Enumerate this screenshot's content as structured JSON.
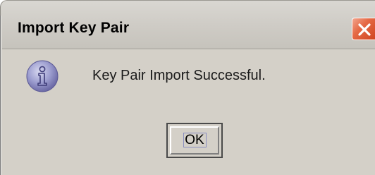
{
  "window": {
    "title": "Import Key Pair",
    "close_icon": "close-x-icon",
    "close_color": "#e05a35"
  },
  "message": {
    "icon": "information-icon",
    "text": "Key Pair Import Successful."
  },
  "buttons": {
    "ok_label": "OK"
  }
}
